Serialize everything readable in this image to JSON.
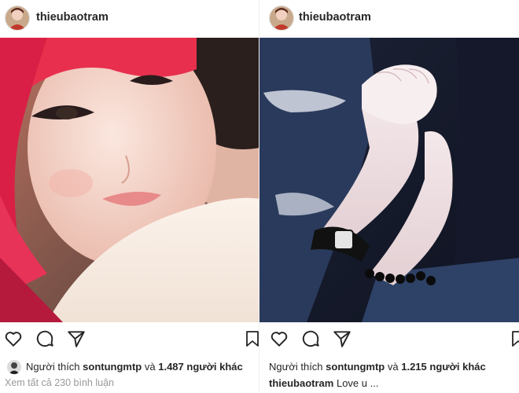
{
  "left_post": {
    "username": "thieubaotram",
    "likes_prefix": "Người thích",
    "likes_user": "sontungmtp",
    "likes_and": "và",
    "likes_count": "1.487 người khác",
    "view_comments": "Xem tất cả 230 bình luận"
  },
  "right_post": {
    "username": "thieubaotram",
    "likes_prefix": "Người thích",
    "likes_user": "sontungmtp",
    "likes_and": "và",
    "likes_count": "1.215 người khác",
    "caption_user": "thieubaotram",
    "caption_text": "Love u ..."
  },
  "icons": [
    "heart-icon",
    "comment-icon",
    "share-icon",
    "bookmark-icon"
  ],
  "colors": {
    "hair": "#e8304e",
    "skin": "#f3d7cb",
    "denim": "#2a3a5c"
  }
}
